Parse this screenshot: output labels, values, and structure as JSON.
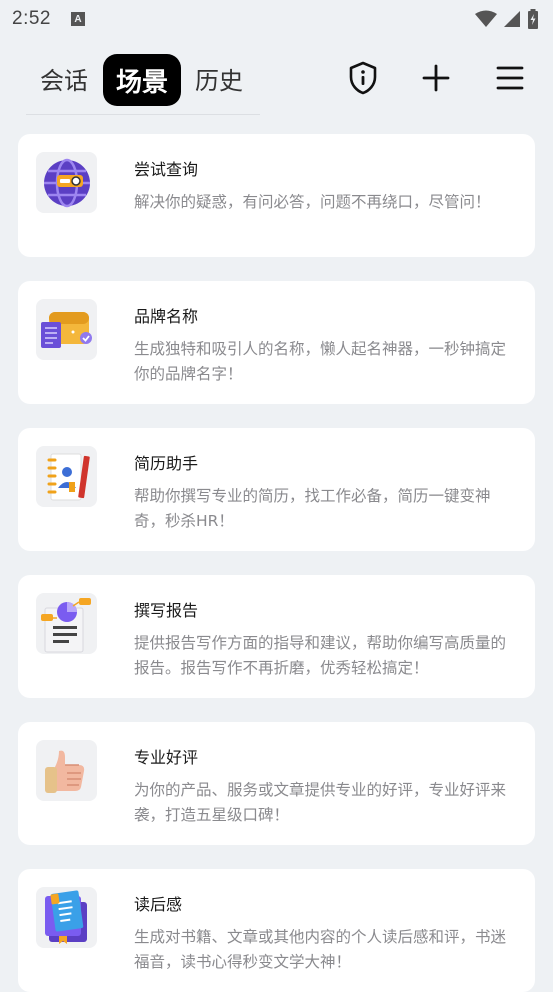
{
  "status_bar": {
    "time": "2:52",
    "notification_icon": "A",
    "icons": [
      "wifi-icon",
      "signal-icon",
      "battery-charging-icon"
    ]
  },
  "top_bar": {
    "tabs": [
      {
        "label": "会话",
        "active": false
      },
      {
        "label": "场景",
        "active": true
      },
      {
        "label": "历史",
        "active": false
      }
    ],
    "actions": [
      "shield-info-icon",
      "plus-icon",
      "menu-icon"
    ]
  },
  "scenes": [
    {
      "title": "尝试查询",
      "desc": "解决你的疑惑，有问必答，问题不再绕口，尽管问！",
      "icon": "globe-search-icon"
    },
    {
      "title": "品牌名称",
      "desc": "生成独特和吸引人的名称，懒人起名神器，一秒钟搞定你的品牌名字！",
      "icon": "wallet-badge-icon"
    },
    {
      "title": "简历助手",
      "desc": "帮助你撰写专业的简历，找工作必备，简历一键变神奇，秒杀HR！",
      "icon": "resume-notebook-icon"
    },
    {
      "title": "撰写报告",
      "desc": "提供报告写作方面的指导和建议，帮助你编写高质量的报告。报告写作不再折磨，优秀轻松搞定！",
      "icon": "report-chart-icon"
    },
    {
      "title": "专业好评",
      "desc": "为你的产品、服务或文章提供专业的好评，专业好评来袭，打造五星级口碑！",
      "icon": "thumbs-up-icon"
    },
    {
      "title": "读后感",
      "desc": "生成对书籍、文章或其他内容的个人读后感和评，书迷福音，读书心得秒变文学大神！",
      "icon": "book-icon"
    }
  ],
  "colors": {
    "background": "#eef1f4",
    "card": "#ffffff",
    "active_tab_bg": "#000000",
    "desc_text": "#8a8a8e"
  }
}
